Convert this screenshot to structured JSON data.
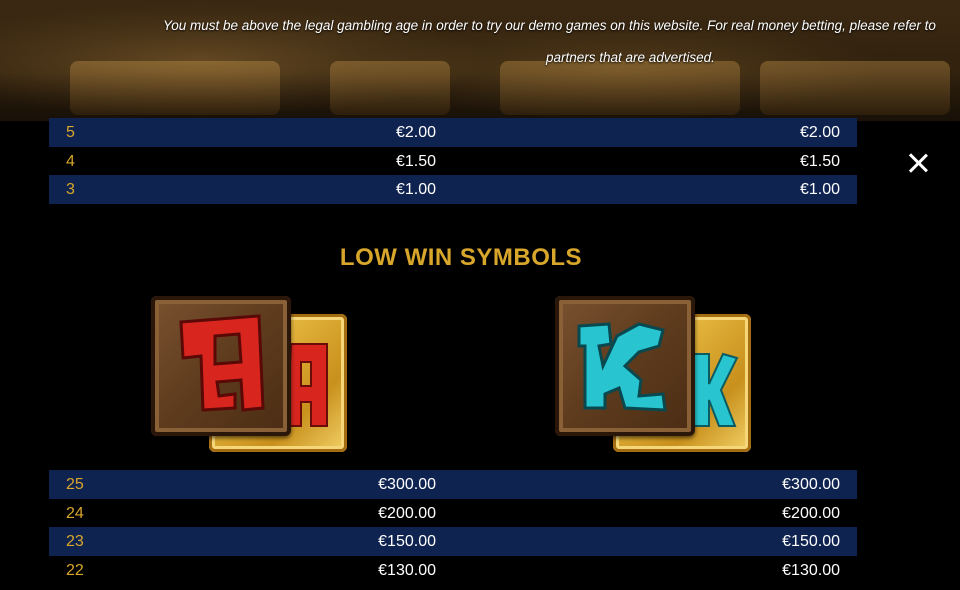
{
  "notice": {
    "line1": "You must be above the legal gambling age in order to try our demo games on this website. For real money betting, please refer to",
    "line2": "partners that are advertised."
  },
  "upper_table": [
    {
      "count": "5",
      "value_a": "€2.00",
      "value_b": "€2.00"
    },
    {
      "count": "4",
      "value_a": "€1.50",
      "value_b": "€1.50"
    },
    {
      "count": "3",
      "value_a": "€1.00",
      "value_b": "€1.00"
    }
  ],
  "section_title": "LOW WIN SYMBOLS",
  "symbols": [
    {
      "icon": "letter-a-symbol-icon",
      "color": "#d8261f"
    },
    {
      "icon": "letter-k-symbol-icon",
      "color": "#28c4cf"
    }
  ],
  "lower_table": [
    {
      "count": "25",
      "value_a": "€300.00",
      "value_b": "€300.00"
    },
    {
      "count": "24",
      "value_a": "€200.00",
      "value_b": "€200.00"
    },
    {
      "count": "23",
      "value_a": "€150.00",
      "value_b": "€150.00"
    },
    {
      "count": "22",
      "value_a": "€130.00",
      "value_b": "€130.00"
    }
  ],
  "colors": {
    "accent": "#d9a62c",
    "row_stripe": "#0f2350",
    "background": "#000000"
  }
}
